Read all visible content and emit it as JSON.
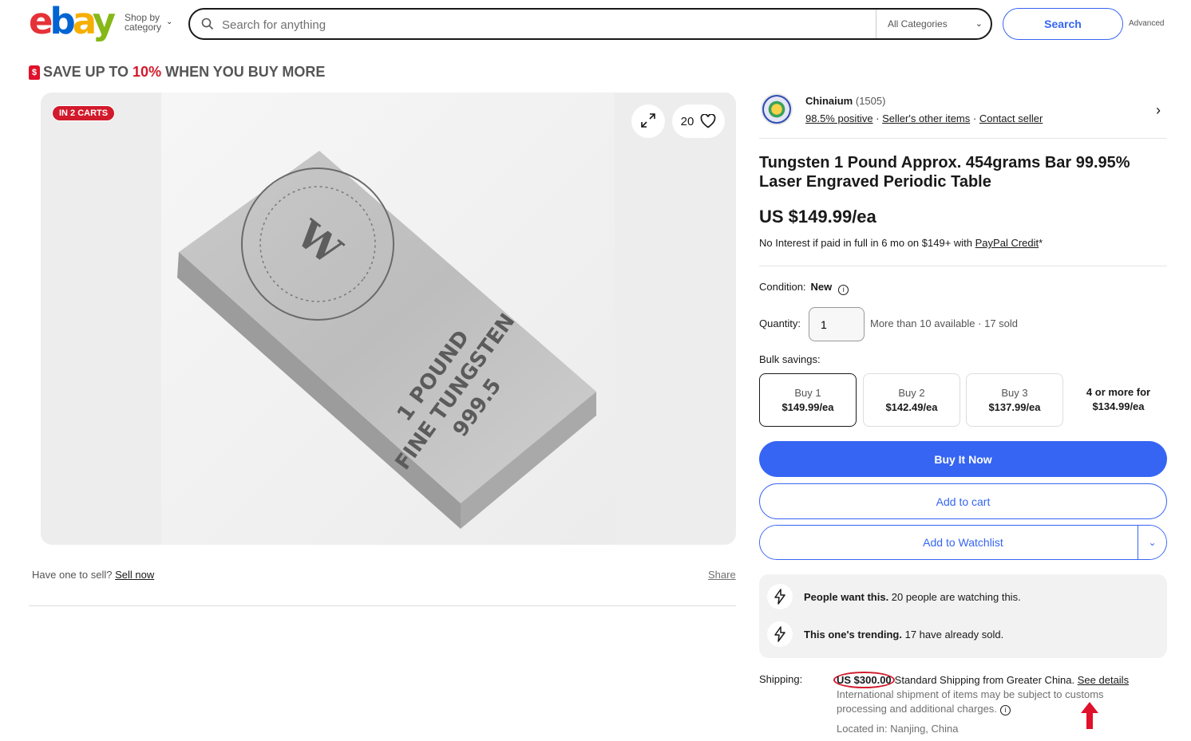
{
  "header": {
    "logo_letters": [
      "e",
      "b",
      "a",
      "y"
    ],
    "shop_by_line1": "Shop by",
    "shop_by_line2": "category",
    "search_placeholder": "Search for anything",
    "category_select": "All Categories",
    "search_button": "Search",
    "advanced_link": "Advanced"
  },
  "promo": {
    "prefix": "SAVE UP TO ",
    "highlight": "10%",
    "suffix": " WHEN YOU BUY MORE",
    "highlight_color": "#d11a2b"
  },
  "gallery": {
    "badge": "IN 2 CARTS",
    "watch_count": "20",
    "engraving_line1": "1 POUND",
    "engraving_line2": "FINE TUNGSTEN",
    "engraving_line3": "999.5",
    "seal_letter": "W"
  },
  "sell_row": {
    "prompt": "Have one to sell? ",
    "sell_link": "Sell now",
    "share_link": "Share"
  },
  "seller": {
    "name": "Chinaium",
    "feedback_count": "(1505)",
    "positive": "98.5% positive",
    "other_items": "Seller's other items",
    "contact": "Contact seller",
    "separator": " · "
  },
  "item": {
    "title": "Tungsten 1 Pound Approx. 454grams Bar 99.95% Laser Engraved Periodic Table",
    "price": "US $149.99/ea",
    "finance_text": "No Interest if paid in full in 6 mo on $149+ with ",
    "finance_link": "PayPal Credit",
    "finance_star": "*",
    "condition_label": "Condition:",
    "condition_value": "New",
    "quantity_label": "Quantity:",
    "quantity_value": "1",
    "availability": "More than 10 available · 17 sold",
    "bulk_label": "Bulk savings:",
    "bulk": [
      {
        "qty": "Buy 1",
        "price": "$149.99/ea"
      },
      {
        "qty": "Buy 2",
        "price": "$142.49/ea"
      },
      {
        "qty": "Buy 3",
        "price": "$137.99/ea"
      },
      {
        "qty": "4 or more for",
        "price": "$134.99/ea"
      }
    ],
    "buy_now": "Buy It Now",
    "add_to_cart": "Add to cart",
    "add_to_watchlist": "Add to Watchlist"
  },
  "signals": [
    {
      "bold": "People want this.",
      "text": " 20 people are watching this."
    },
    {
      "bold": "This one's trending.",
      "text": " 17 have already sold."
    }
  ],
  "shipping": {
    "label": "Shipping:",
    "price": "US $300.00",
    "method": "Standard Shipping from Greater China. ",
    "details_link": "See details",
    "note": "International shipment of items may be subject to customs processing and additional charges.",
    "location": "Located in: Nanjing, China"
  },
  "colors": {
    "brand_blue": "#3665f3",
    "alert_red": "#d11a2b"
  },
  "icons": [
    "search-icon",
    "chevron-down-icon",
    "expand-icon",
    "heart-icon",
    "chevron-right-icon",
    "info-icon",
    "lightning-icon",
    "arrow-up-icon",
    "tag-icon"
  ]
}
